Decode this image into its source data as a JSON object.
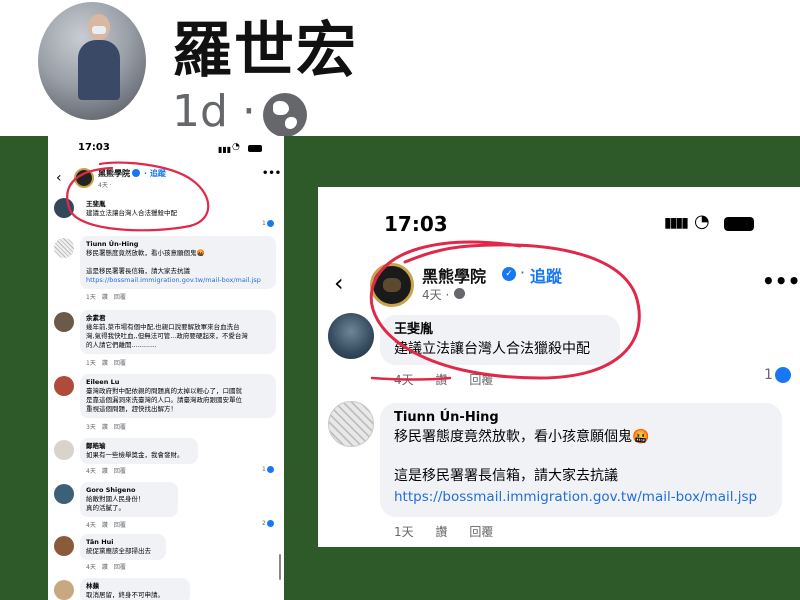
{
  "header": {
    "name": "羅世宏",
    "time": "1d ·",
    "globe_icon": "globe-icon"
  },
  "left_phone": {
    "status_time": "17:03",
    "page": {
      "name": "黑熊學院",
      "follow": "· 追蹤",
      "time": "4天 · "
    },
    "comments": [
      {
        "name": "王斐胤",
        "lines": [
          "建議立法讓台灣人合法獵殺中配"
        ],
        "meta": "",
        "react": "1"
      },
      {
        "name": "Tiunn Ún-Hing",
        "lines": [
          "移民署態度竟然放軟，看小孩意願個鬼🤬",
          "",
          "這是移民署署長信箱，請大家去抗議"
        ],
        "link": "https://bossmail.immigration.gov.tw/mail-box/mail.jsp",
        "meta": "1天　讚　回覆",
        "react": ""
      },
      {
        "name": "余素君",
        "lines": [
          "幾年前,菜市場有個中配,也親口說要解放軍來台血洗台",
          "灣,氣得我快吐血,,但無法可管...政府要硬起來，不愛台灣",
          "的人請它們離開............"
        ],
        "meta": "1天　讚　回覆",
        "react": ""
      },
      {
        "name": "Eileen Lu",
        "lines": [
          "臺灣政府對中配依親的問題真的太掉以輕心了，口國就",
          "是靠這個漏洞來洗臺灣的人口。請臺灣政府跟國安單位",
          "重視這個問題，趕快找出解方！"
        ],
        "meta": "3天　讚　回覆",
        "react": ""
      },
      {
        "name": "鄭皓瑜",
        "lines": [
          "如果有一些檢舉獎金，我會發財。"
        ],
        "meta": "4天　讚　回覆",
        "react": "1"
      },
      {
        "name": "Goro Shigeno",
        "lines": [
          "給敵對國人民身份！",
          "真的活膩了。"
        ],
        "meta": "4天　讚　回覆",
        "react": "2"
      },
      {
        "name": "Tân Hui",
        "lines": [
          "統促黨應該全部掃出去"
        ],
        "meta": "4天　讚　回覆",
        "react": ""
      },
      {
        "name": "林蘋",
        "lines": [
          "取消居留，終身不可申請。"
        ],
        "meta": "",
        "react": ""
      }
    ]
  },
  "right_phone": {
    "status_time": "17:03",
    "page": {
      "name": "黑熊學院",
      "sep": "·",
      "follow": "追蹤",
      "time": "4天 ·"
    },
    "comment1": {
      "name": "王斐胤",
      "text": "建議立法讓台灣人合法獵殺中配",
      "meta": [
        "4天",
        "讚",
        "回覆"
      ],
      "react": "1"
    },
    "comment2": {
      "name": "Tiunn Ún-Hing",
      "line1": "移民署態度竟然放軟，看小孩意願個鬼🤬",
      "line2": "這是移民署署長信箱，請大家去抗議",
      "link": "https://bossmail.immigration.gov.tw/mail-box/mail.jsp",
      "meta": [
        "1天",
        "讚",
        "回覆"
      ]
    }
  },
  "colors": {
    "green_bg": "#2e5a2a",
    "facebook_blue": "#1877f2",
    "link_blue": "#216fdb",
    "highlight_red": "#e0284a"
  }
}
